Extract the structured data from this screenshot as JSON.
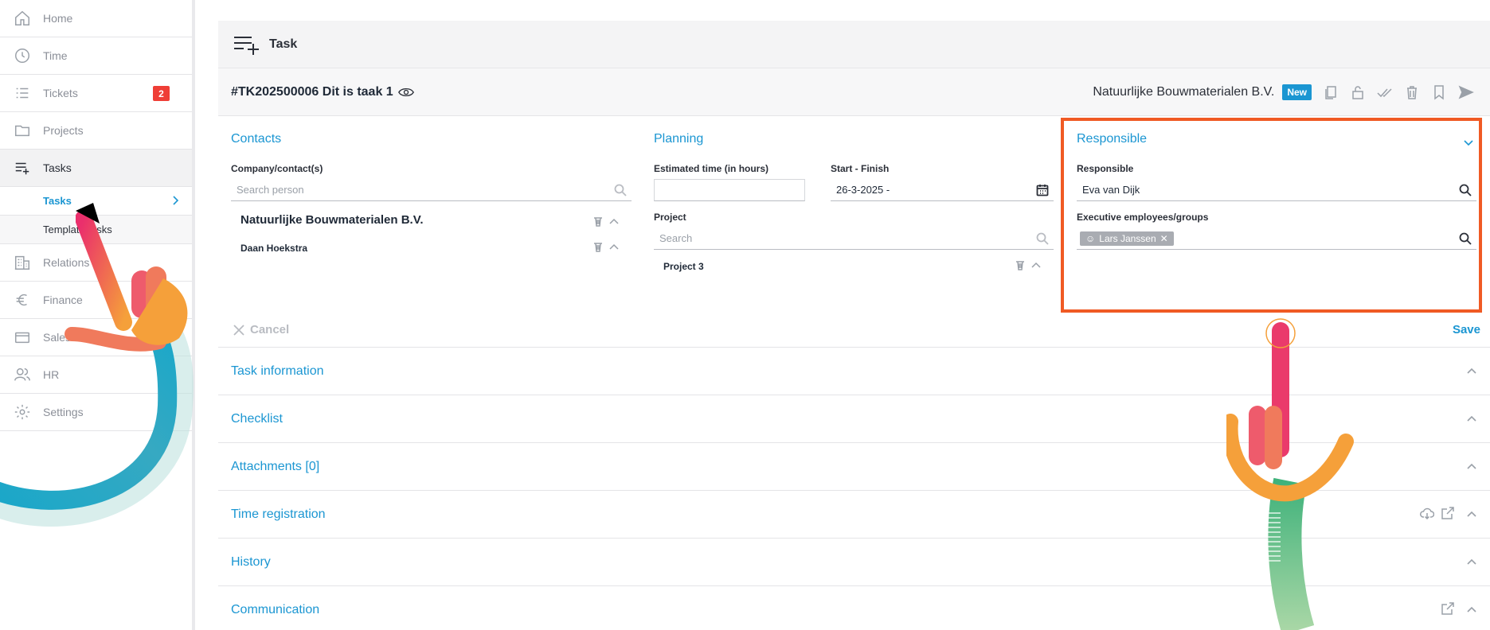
{
  "sidebar": {
    "items": [
      {
        "label": "Home",
        "icon": "home-icon"
      },
      {
        "label": "Time",
        "icon": "clock-icon"
      },
      {
        "label": "Tickets",
        "icon": "list-icon",
        "badge": "2"
      },
      {
        "label": "Projects",
        "icon": "folder-icon"
      },
      {
        "label": "Tasks",
        "icon": "task-list-plus-icon"
      },
      {
        "label": "Relations",
        "icon": "building-icon"
      },
      {
        "label": "Finance",
        "icon": "euro-icon"
      },
      {
        "label": "Sales",
        "icon": "card-icon"
      },
      {
        "label": "HR",
        "icon": "users-icon"
      },
      {
        "label": "Settings",
        "icon": "gear-icon"
      }
    ],
    "subitems": [
      {
        "label": "Tasks"
      },
      {
        "label": "Template tasks"
      }
    ]
  },
  "header": {
    "title": "Task"
  },
  "task": {
    "code": "#TK202500006 Dit is taak 1",
    "company": "Natuurlijke Bouwmaterialen B.V.",
    "status": "New"
  },
  "contacts": {
    "title": "Contacts",
    "label": "Company/contact(s)",
    "placeholder": "Search person",
    "company": "Natuurlijke Bouwmaterialen B.V.",
    "person": "Daan Hoekstra"
  },
  "planning": {
    "title": "Planning",
    "est_label": "Estimated time (in hours)",
    "est_value": "",
    "start_label": "Start - Finish",
    "start_value": "26-3-2025 -",
    "project_label": "Project",
    "project_placeholder": "Search",
    "project_value": "Project 3"
  },
  "responsible": {
    "title": "Responsible",
    "label": "Responsible",
    "value": "Eva van Dijk",
    "exec_label": "Executive employees/groups",
    "chip": "Lars Janssen"
  },
  "actions": {
    "cancel": "Cancel",
    "save": "Save"
  },
  "sections": [
    "Task information",
    "Checklist",
    "Attachments [0]",
    "Time registration",
    "History",
    "Communication"
  ],
  "colors": {
    "accent": "#1b96d2",
    "highlight": "#f05a24",
    "badge": "#ef3e36"
  }
}
